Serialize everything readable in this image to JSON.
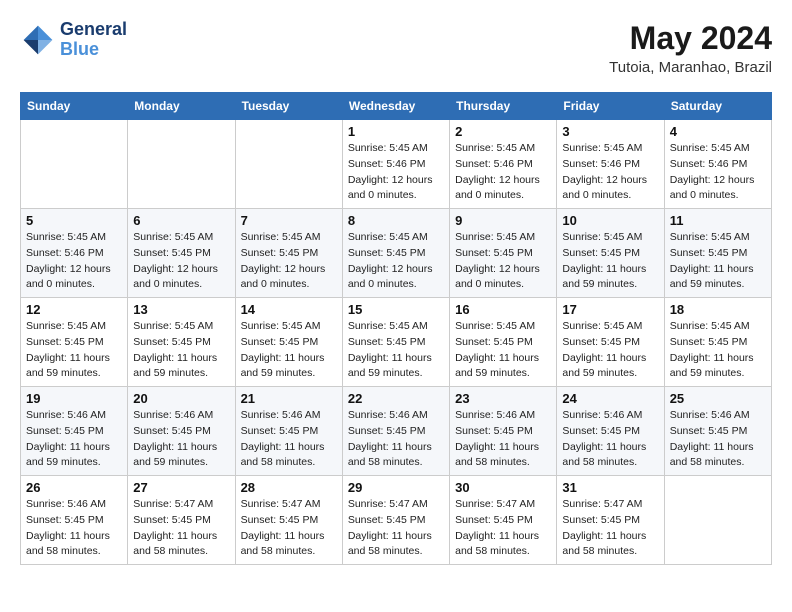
{
  "header": {
    "logo_line1": "General",
    "logo_line2": "Blue",
    "month_year": "May 2024",
    "location": "Tutoia, Maranhao, Brazil"
  },
  "days_of_week": [
    "Sunday",
    "Monday",
    "Tuesday",
    "Wednesday",
    "Thursday",
    "Friday",
    "Saturday"
  ],
  "weeks": [
    [
      {
        "day": "",
        "info": ""
      },
      {
        "day": "",
        "info": ""
      },
      {
        "day": "",
        "info": ""
      },
      {
        "day": "1",
        "info": "Sunrise: 5:45 AM\nSunset: 5:46 PM\nDaylight: 12 hours\nand 0 minutes."
      },
      {
        "day": "2",
        "info": "Sunrise: 5:45 AM\nSunset: 5:46 PM\nDaylight: 12 hours\nand 0 minutes."
      },
      {
        "day": "3",
        "info": "Sunrise: 5:45 AM\nSunset: 5:46 PM\nDaylight: 12 hours\nand 0 minutes."
      },
      {
        "day": "4",
        "info": "Sunrise: 5:45 AM\nSunset: 5:46 PM\nDaylight: 12 hours\nand 0 minutes."
      }
    ],
    [
      {
        "day": "5",
        "info": "Sunrise: 5:45 AM\nSunset: 5:46 PM\nDaylight: 12 hours\nand 0 minutes."
      },
      {
        "day": "6",
        "info": "Sunrise: 5:45 AM\nSunset: 5:45 PM\nDaylight: 12 hours\nand 0 minutes."
      },
      {
        "day": "7",
        "info": "Sunrise: 5:45 AM\nSunset: 5:45 PM\nDaylight: 12 hours\nand 0 minutes."
      },
      {
        "day": "8",
        "info": "Sunrise: 5:45 AM\nSunset: 5:45 PM\nDaylight: 12 hours\nand 0 minutes."
      },
      {
        "day": "9",
        "info": "Sunrise: 5:45 AM\nSunset: 5:45 PM\nDaylight: 12 hours\nand 0 minutes."
      },
      {
        "day": "10",
        "info": "Sunrise: 5:45 AM\nSunset: 5:45 PM\nDaylight: 11 hours\nand 59 minutes."
      },
      {
        "day": "11",
        "info": "Sunrise: 5:45 AM\nSunset: 5:45 PM\nDaylight: 11 hours\nand 59 minutes."
      }
    ],
    [
      {
        "day": "12",
        "info": "Sunrise: 5:45 AM\nSunset: 5:45 PM\nDaylight: 11 hours\nand 59 minutes."
      },
      {
        "day": "13",
        "info": "Sunrise: 5:45 AM\nSunset: 5:45 PM\nDaylight: 11 hours\nand 59 minutes."
      },
      {
        "day": "14",
        "info": "Sunrise: 5:45 AM\nSunset: 5:45 PM\nDaylight: 11 hours\nand 59 minutes."
      },
      {
        "day": "15",
        "info": "Sunrise: 5:45 AM\nSunset: 5:45 PM\nDaylight: 11 hours\nand 59 minutes."
      },
      {
        "day": "16",
        "info": "Sunrise: 5:45 AM\nSunset: 5:45 PM\nDaylight: 11 hours\nand 59 minutes."
      },
      {
        "day": "17",
        "info": "Sunrise: 5:45 AM\nSunset: 5:45 PM\nDaylight: 11 hours\nand 59 minutes."
      },
      {
        "day": "18",
        "info": "Sunrise: 5:45 AM\nSunset: 5:45 PM\nDaylight: 11 hours\nand 59 minutes."
      }
    ],
    [
      {
        "day": "19",
        "info": "Sunrise: 5:46 AM\nSunset: 5:45 PM\nDaylight: 11 hours\nand 59 minutes."
      },
      {
        "day": "20",
        "info": "Sunrise: 5:46 AM\nSunset: 5:45 PM\nDaylight: 11 hours\nand 59 minutes."
      },
      {
        "day": "21",
        "info": "Sunrise: 5:46 AM\nSunset: 5:45 PM\nDaylight: 11 hours\nand 58 minutes."
      },
      {
        "day": "22",
        "info": "Sunrise: 5:46 AM\nSunset: 5:45 PM\nDaylight: 11 hours\nand 58 minutes."
      },
      {
        "day": "23",
        "info": "Sunrise: 5:46 AM\nSunset: 5:45 PM\nDaylight: 11 hours\nand 58 minutes."
      },
      {
        "day": "24",
        "info": "Sunrise: 5:46 AM\nSunset: 5:45 PM\nDaylight: 11 hours\nand 58 minutes."
      },
      {
        "day": "25",
        "info": "Sunrise: 5:46 AM\nSunset: 5:45 PM\nDaylight: 11 hours\nand 58 minutes."
      }
    ],
    [
      {
        "day": "26",
        "info": "Sunrise: 5:46 AM\nSunset: 5:45 PM\nDaylight: 11 hours\nand 58 minutes."
      },
      {
        "day": "27",
        "info": "Sunrise: 5:47 AM\nSunset: 5:45 PM\nDaylight: 11 hours\nand 58 minutes."
      },
      {
        "day": "28",
        "info": "Sunrise: 5:47 AM\nSunset: 5:45 PM\nDaylight: 11 hours\nand 58 minutes."
      },
      {
        "day": "29",
        "info": "Sunrise: 5:47 AM\nSunset: 5:45 PM\nDaylight: 11 hours\nand 58 minutes."
      },
      {
        "day": "30",
        "info": "Sunrise: 5:47 AM\nSunset: 5:45 PM\nDaylight: 11 hours\nand 58 minutes."
      },
      {
        "day": "31",
        "info": "Sunrise: 5:47 AM\nSunset: 5:45 PM\nDaylight: 11 hours\nand 58 minutes."
      },
      {
        "day": "",
        "info": ""
      }
    ]
  ]
}
